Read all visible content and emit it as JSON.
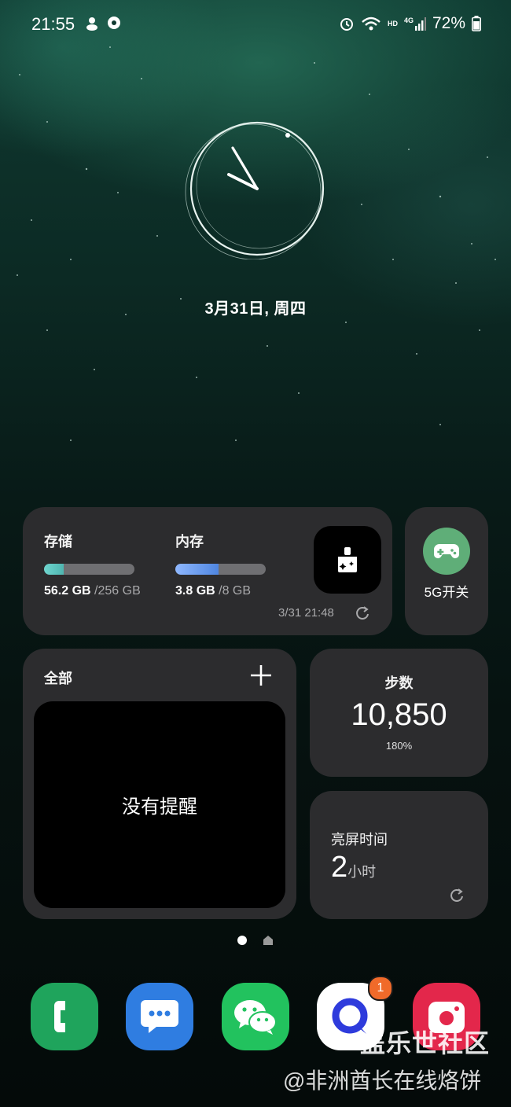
{
  "status_bar": {
    "time": "21:55",
    "battery": "72%",
    "network_hd": "HD",
    "network_4g": "4G"
  },
  "lockscreen": {
    "date": "3月31日, 周四"
  },
  "storage_widget": {
    "storage_label": "存储",
    "storage_used": "56.2 GB",
    "storage_total": " /256 GB",
    "storage_fraction": 0.22,
    "memory_label": "内存",
    "memory_used": "3.8 GB",
    "memory_total": " /8 GB",
    "memory_fraction": 0.475,
    "updated": "3/31 21:48",
    "clean_icon": "broom-sparkle-icon"
  },
  "toggle_widget": {
    "label": "5G开关",
    "icon": "gamepad-icon",
    "icon_color": "#5fae78"
  },
  "reminder_widget": {
    "title": "全部",
    "empty_text": "没有提醒"
  },
  "steps_widget": {
    "title": "步数",
    "count": "10,850",
    "percent": "180%"
  },
  "screen_time_widget": {
    "title": "亮屏时间",
    "value": "2",
    "unit": "小时"
  },
  "dock": {
    "apps": [
      {
        "name": "phone",
        "color": "#1fa45c"
      },
      {
        "name": "messages",
        "color": "#2f7de1"
      },
      {
        "name": "wechat",
        "color": "#22c25e"
      },
      {
        "name": "browser",
        "color": "#ffffff",
        "badge": "1"
      },
      {
        "name": "camera",
        "color": "#e3274b"
      }
    ]
  },
  "watermark": {
    "line1": "盖乐世社区",
    "line2": "@非洲酋长在线烙饼"
  }
}
